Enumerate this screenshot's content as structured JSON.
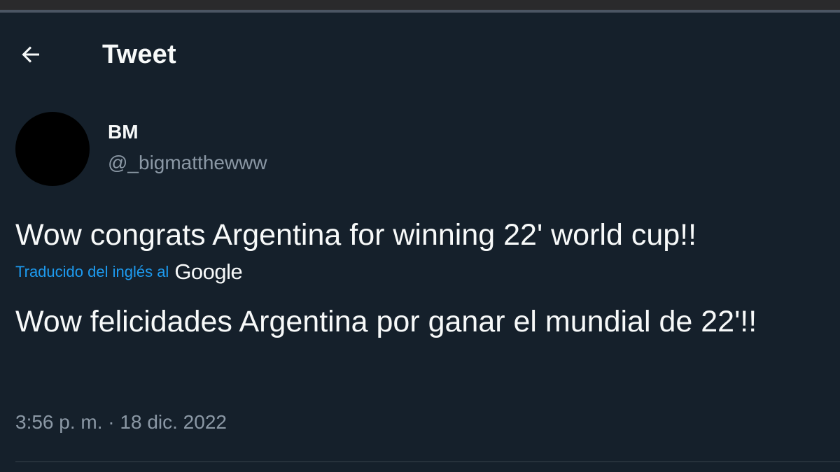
{
  "header": {
    "title": "Tweet"
  },
  "tweet": {
    "author": {
      "display_name": "BM",
      "handle": "@_bigmatthewww"
    },
    "text": "Wow congrats Argentina for winning 22' world cup!!",
    "translation": {
      "label": "Traducido del inglés al",
      "provider": "Google",
      "text": "Wow felicidades Argentina por ganar el mundial de 22'!!"
    },
    "timestamp": "3:56 p. m. · 18 dic. 2022"
  },
  "icons": {
    "back": "arrow-left-icon"
  },
  "colors": {
    "background": "#15202b",
    "text_primary": "#f7f9f9",
    "text_secondary": "#8b98a5",
    "link": "#1d9bf0",
    "divider": "#38444d"
  }
}
